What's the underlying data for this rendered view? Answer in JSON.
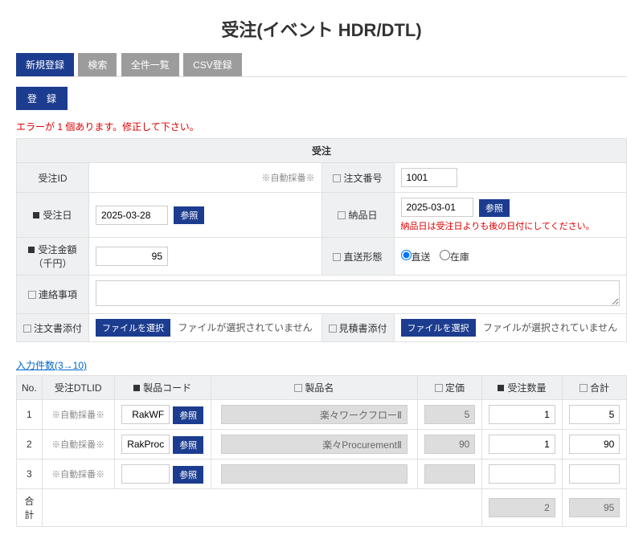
{
  "title": "受注(イベント HDR/DTL)",
  "tabs": {
    "t0": "新規登録",
    "t1": "検索",
    "t2": "全件一覧",
    "t3": "CSV登録"
  },
  "register_btn": "登　録",
  "error_summary": "エラーが 1 個あります。修正して下さい。",
  "form_caption": "受注",
  "labels": {
    "order_id": "受注ID",
    "auto_num": "※自動採番※",
    "order_no": "注文番号",
    "order_date": "受注日",
    "due_date": "納品日",
    "amount": "受注金額（千円）",
    "ship_type": "直送形態",
    "memo": "連絡事項",
    "order_attach": "注文書添付",
    "quote_attach": "見積書添付",
    "ref_btn": "参照",
    "file_btn": "ファイルを選択",
    "no_file": "ファイルが選択されていません"
  },
  "values": {
    "order_no": "1001",
    "order_date": "2025-03-28",
    "due_date": "2025-03-01",
    "amount": "95"
  },
  "due_date_error": "納品日は受注日よりも後の日付にしてください。",
  "ship": {
    "opt1": "直送",
    "opt2": "在庫"
  },
  "count_link": "入力件数(3→10)",
  "dtl_headers": {
    "no": "No.",
    "dtlid": "受注DTLID",
    "code": "製品コード",
    "name": "製品名",
    "price": "定価",
    "qty": "受注数量",
    "total": "合計"
  },
  "dtl_rows": [
    {
      "no": "1",
      "dtlid": "※自動採番※",
      "code": "RakWF",
      "name": "楽々ワークフローⅡ",
      "price": "5",
      "qty": "1",
      "total": "5"
    },
    {
      "no": "2",
      "dtlid": "※自動採番※",
      "code": "RakProc",
      "name": "楽々ProcurementⅡ",
      "price": "90",
      "qty": "1",
      "total": "90"
    },
    {
      "no": "3",
      "dtlid": "※自動採番※",
      "code": "",
      "name": "",
      "price": "",
      "qty": "",
      "total": ""
    }
  ],
  "footer": {
    "label": "合計",
    "qty": "2",
    "total": "95"
  }
}
